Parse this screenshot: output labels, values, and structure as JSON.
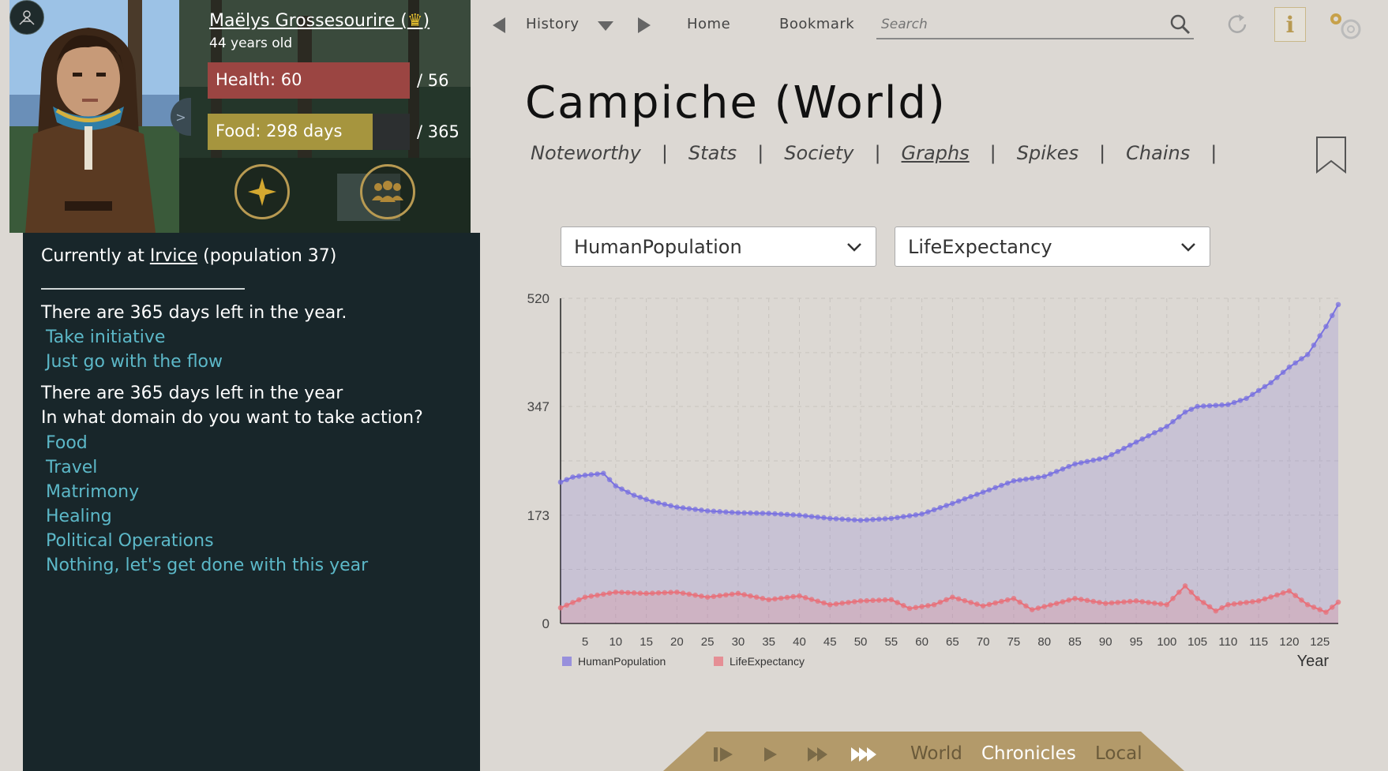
{
  "character": {
    "name": "Maëlys Grossesourire (",
    "name_suffix": ")",
    "age": "44 years old",
    "health_label": "Health: 60",
    "health_value": 60,
    "health_max_label": "/ 56",
    "food_label": "Food: 298 days",
    "food_value": 298,
    "food_max_label": "/ 365",
    "food_max": 365
  },
  "left_panel": {
    "location_prefix": "Currently at ",
    "location_name": "Irvice",
    "location_suffix": " (population 37)",
    "line1": "There are 365 days left in the year.",
    "options1": [
      "Take initiative",
      "Just go with the flow"
    ],
    "line2": "There are 365 days left in the year",
    "line3": "In what domain do you want to take action?",
    "options2": [
      "Food",
      "Travel",
      "Matrimony",
      "Healing",
      "Political Operations",
      "Nothing, let's get done with this year"
    ]
  },
  "nav": {
    "history": "History",
    "home": "Home",
    "bookmark": "Bookmark",
    "search_placeholder": "Search"
  },
  "page": {
    "title": "Campiche (World)",
    "tabs": [
      "Noteworthy",
      "Stats",
      "Society",
      "Graphs",
      "Spikes",
      "Chains"
    ],
    "active_tab": "Graphs"
  },
  "dropdowns": {
    "left": "HumanPopulation",
    "right": "LifeExpectancy"
  },
  "bottom_bar": {
    "world": "World",
    "chronicles": "Chronicles",
    "local": "Local"
  },
  "colors": {
    "population": "#7a72e0",
    "life": "#e8707a",
    "accent_gold": "#b89a52",
    "link": "#5cb8c8"
  },
  "chart_data": {
    "type": "area",
    "xlabel": "Year",
    "ylabel": "",
    "y_ticks": [
      "0",
      "173",
      "347",
      "520"
    ],
    "x_ticks": [
      "5",
      "10",
      "15",
      "20",
      "25",
      "30",
      "35",
      "40",
      "45",
      "50",
      "55",
      "60",
      "65",
      "70",
      "75",
      "80",
      "85",
      "90",
      "95",
      "100",
      "105",
      "110",
      "115",
      "120",
      "125"
    ],
    "xlim": [
      1,
      128
    ],
    "ylim": [
      0,
      520
    ],
    "grid": true,
    "legend": "bottom-left",
    "series": [
      {
        "name": "HumanPopulation",
        "points": [
          [
            1,
            226
          ],
          [
            3,
            234
          ],
          [
            5,
            237
          ],
          [
            8,
            240
          ],
          [
            10,
            220
          ],
          [
            13,
            205
          ],
          [
            16,
            195
          ],
          [
            20,
            186
          ],
          [
            25,
            180
          ],
          [
            30,
            177
          ],
          [
            35,
            176
          ],
          [
            40,
            173
          ],
          [
            45,
            168
          ],
          [
            50,
            165
          ],
          [
            55,
            168
          ],
          [
            60,
            175
          ],
          [
            65,
            192
          ],
          [
            70,
            210
          ],
          [
            75,
            228
          ],
          [
            80,
            235
          ],
          [
            85,
            255
          ],
          [
            90,
            265
          ],
          [
            95,
            290
          ],
          [
            100,
            315
          ],
          [
            103,
            338
          ],
          [
            105,
            347
          ],
          [
            110,
            350
          ],
          [
            113,
            360
          ],
          [
            117,
            385
          ],
          [
            120,
            410
          ],
          [
            123,
            430
          ],
          [
            126,
            475
          ],
          [
            128,
            510
          ]
        ]
      },
      {
        "name": "LifeExpectancy",
        "points": [
          [
            1,
            25
          ],
          [
            5,
            42
          ],
          [
            10,
            50
          ],
          [
            15,
            48
          ],
          [
            20,
            50
          ],
          [
            25,
            42
          ],
          [
            30,
            48
          ],
          [
            35,
            38
          ],
          [
            40,
            44
          ],
          [
            45,
            30
          ],
          [
            50,
            36
          ],
          [
            55,
            38
          ],
          [
            58,
            24
          ],
          [
            62,
            30
          ],
          [
            65,
            42
          ],
          [
            70,
            28
          ],
          [
            75,
            40
          ],
          [
            78,
            22
          ],
          [
            82,
            32
          ],
          [
            85,
            40
          ],
          [
            90,
            32
          ],
          [
            95,
            36
          ],
          [
            100,
            30
          ],
          [
            103,
            60
          ],
          [
            105,
            40
          ],
          [
            108,
            20
          ],
          [
            110,
            30
          ],
          [
            115,
            36
          ],
          [
            120,
            52
          ],
          [
            123,
            30
          ],
          [
            126,
            18
          ],
          [
            128,
            34
          ]
        ]
      }
    ]
  }
}
